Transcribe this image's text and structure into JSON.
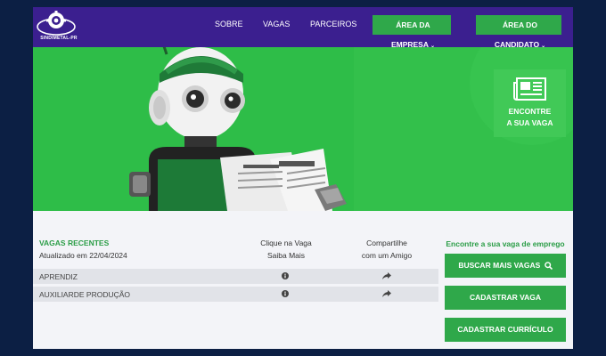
{
  "logo": {
    "text": "SINDIMETAL-PR"
  },
  "nav": {
    "links": [
      "SOBRE",
      "VAGAS",
      "PARCEIROS"
    ],
    "company_area": "ÁREA DA EMPRESA",
    "candidate_area": "ÁREA DO CANDIDATO"
  },
  "hero": {
    "find_line1": "ENCONTRE",
    "find_line2": "A SUA VAGA"
  },
  "jobs": {
    "title": "VAGAS RECENTES",
    "updated": "Atualizado em 22/04/2024",
    "col_click_1": "Clique na Vaga",
    "col_click_2": "Saiba Mais",
    "col_share_1": "Compartilhe",
    "col_share_2": "com um Amigo",
    "rows": [
      {
        "name": "APRENDIZ"
      },
      {
        "name": "AUXILIARDE PRODUÇÃO"
      }
    ]
  },
  "cta": {
    "title": "Encontre a sua vaga de emprego",
    "search": "BUSCAR MAIS VAGAS",
    "register_job": "CADASTRAR VAGA",
    "register_cv": "CADASTRAR CURRÍCULO"
  },
  "colors": {
    "header": "#3b1f8f",
    "hero": "#2ebd48",
    "accent_green": "#2fa84a",
    "page_bg": "#0c1f44"
  },
  "icons": [
    "logo-gear-icon",
    "chevron-down-icon",
    "newspaper-icon",
    "info-icon",
    "share-icon",
    "search-icon"
  ]
}
